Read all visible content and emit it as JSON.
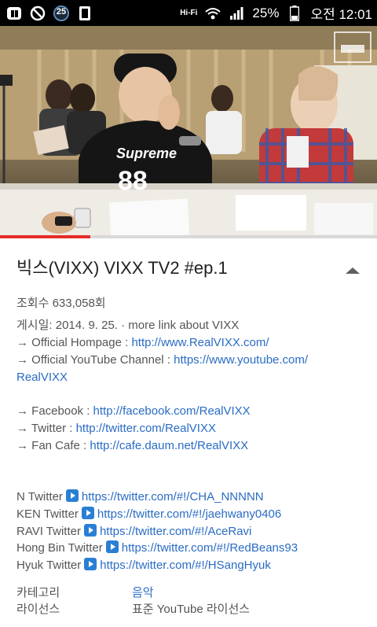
{
  "status_bar": {
    "notification_count": "25",
    "hifi_label": "Hi-Fi",
    "battery": "25%",
    "time": "오전 12:01"
  },
  "video": {
    "shirt_text": "Supreme",
    "shirt_number": "88",
    "progress_percent": 24
  },
  "video_info": {
    "title": "빅스(VIXX) VIXX TV2 #ep.1",
    "views": "조회수 633,058회",
    "published_prefix": "게시일: 2014. 9. 25. · more link about VIXX",
    "arrow": "→",
    "hompage_label": "→ Official Hompage : ",
    "hompage_url": "http://www.RealVIXX.com/",
    "youtube_label": "→ Official YouTube Channel : ",
    "youtube_url_1": "https://www.youtube.com/",
    "youtube_url_2": "RealVIXX",
    "facebook_label": "→ Facebook : ",
    "facebook_url": "http://facebook.com/RealVIXX",
    "twitter_label": "→ Twitter : ",
    "twitter_url": "http://twitter.com/RealVIXX",
    "fancafe_label": "→ Fan Cafe : ",
    "fancafe_url": "http://cafe.daum.net/RealVIXX",
    "member_twitters": [
      {
        "name": "N Twitter",
        "url": "https://twitter.com/#!/CHA_NNNNN"
      },
      {
        "name": "KEN Twitter",
        "url": "https://twitter.com/#!/jaehwany0406"
      },
      {
        "name": "RAVI Twitter",
        "url": "https://twitter.com/#!/AceRavi"
      },
      {
        "name": "Hong Bin Twitter",
        "url": "https://twitter.com/#!/RedBeans93"
      },
      {
        "name": "Hyuk Twitter",
        "url": "https://twitter.com/#!/HSangHyuk"
      }
    ],
    "category_label": "카테고리",
    "category_value": "음악",
    "license_label": "라이선스",
    "license_value": "표준 YouTube 라이선스"
  },
  "colors": {
    "link": "#2a6cc4",
    "progress": "#e52d27",
    "play_icon": "#2a7fd4"
  }
}
